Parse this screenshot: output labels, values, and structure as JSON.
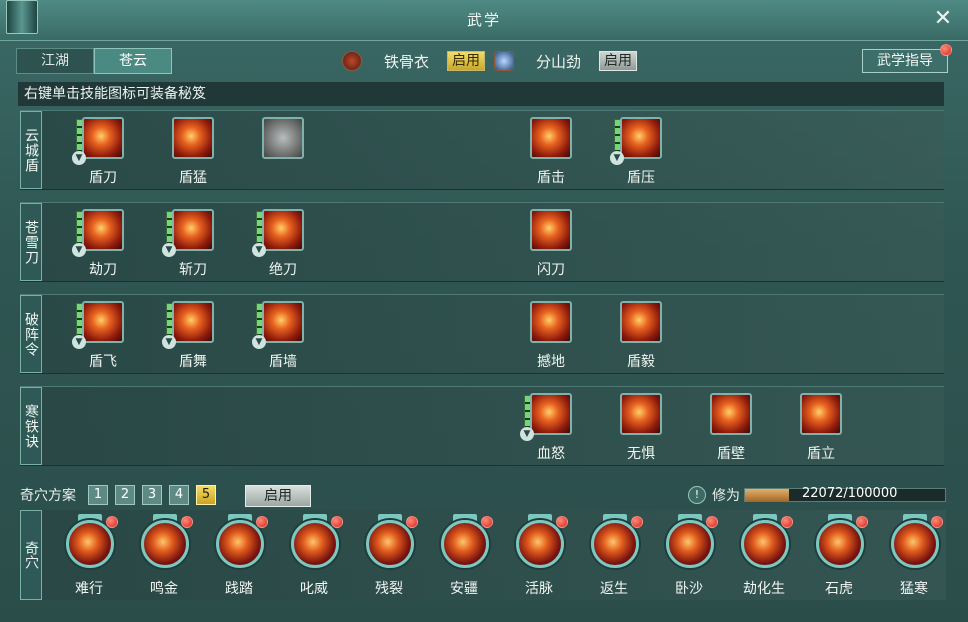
{
  "window": {
    "title": "武学",
    "close_label": "✕"
  },
  "tabs": [
    {
      "label": "江湖",
      "active": false
    },
    {
      "label": "苍云",
      "active": true
    }
  ],
  "stances": [
    {
      "name": "铁骨衣",
      "button": "启用",
      "icon": "shield-stance-icon"
    },
    {
      "name": "分山劲",
      "button": "启用",
      "icon": "blade-stance-icon"
    }
  ],
  "guide_button": "武学指导",
  "hint": "右键单击技能图标可装备秘笈",
  "rows": [
    {
      "label": "云城盾",
      "skills": [
        {
          "name": "盾刀",
          "bars": true,
          "arrow": true,
          "style": "red"
        },
        {
          "name": "盾猛",
          "bars": false,
          "arrow": false,
          "style": "red"
        },
        {
          "name": "",
          "bars": false,
          "arrow": false,
          "style": "grey"
        },
        {
          "name": "盾击",
          "bars": false,
          "arrow": false,
          "style": "red"
        },
        {
          "name": "盾压",
          "bars": true,
          "arrow": true,
          "style": "red"
        }
      ]
    },
    {
      "label": "苍雪刀",
      "skills": [
        {
          "name": "劫刀",
          "bars": true,
          "arrow": true,
          "style": "red"
        },
        {
          "name": "斩刀",
          "bars": true,
          "arrow": true,
          "style": "red"
        },
        {
          "name": "绝刀",
          "bars": true,
          "arrow": true,
          "style": "red"
        },
        {
          "name": "闪刀",
          "bars": false,
          "arrow": false,
          "style": "red"
        }
      ]
    },
    {
      "label": "破阵令",
      "skills": [
        {
          "name": "盾飞",
          "bars": true,
          "arrow": true,
          "style": "red"
        },
        {
          "name": "盾舞",
          "bars": true,
          "arrow": true,
          "style": "red"
        },
        {
          "name": "盾墙",
          "bars": true,
          "arrow": true,
          "style": "red"
        },
        {
          "name": "撼地",
          "bars": false,
          "arrow": false,
          "style": "red"
        },
        {
          "name": "盾毅",
          "bars": false,
          "arrow": false,
          "style": "red"
        }
      ]
    },
    {
      "label": "寒铁诀",
      "skills": [
        {
          "name": "血怒",
          "bars": true,
          "arrow": true,
          "style": "red"
        },
        {
          "name": "无惧",
          "bars": false,
          "arrow": false,
          "style": "red"
        },
        {
          "name": "盾壁",
          "bars": false,
          "arrow": false,
          "style": "red"
        },
        {
          "name": "盾立",
          "bars": false,
          "arrow": false,
          "style": "red"
        }
      ]
    }
  ],
  "scheme": {
    "label": "奇穴方案",
    "numbers": [
      "1",
      "2",
      "3",
      "4",
      "5"
    ],
    "active": "5",
    "apply": "启用"
  },
  "xiuwei": {
    "label": "修为",
    "text": "22072/100000",
    "fraction": 0.22072,
    "info": "!"
  },
  "qixue": {
    "label": "奇穴",
    "talents": [
      "难行",
      "鸣金",
      "践踏",
      "叱威",
      "残裂",
      "安疆",
      "活脉",
      "返生",
      "卧沙",
      "劫化生",
      "石虎",
      "猛寒"
    ]
  }
}
